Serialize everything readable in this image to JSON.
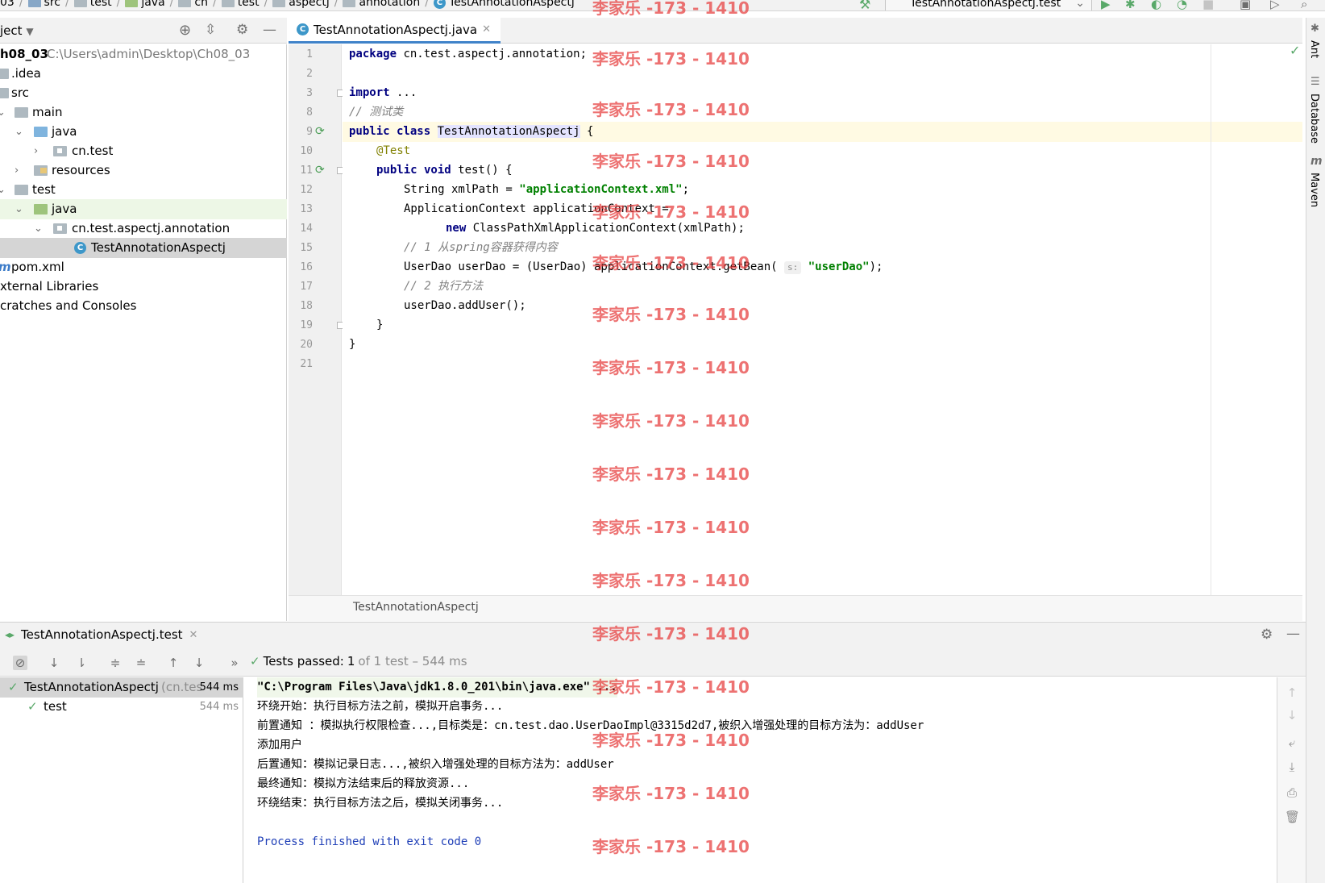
{
  "breadcrumb": [
    "03",
    "src",
    "test",
    "java",
    "cn",
    "test",
    "aspectj",
    "annotation",
    "TestAnnotationAspectj"
  ],
  "run_config": {
    "label": "TestAnnotationAspectj.test"
  },
  "project_panel": {
    "title": "ject",
    "tree": [
      {
        "label": "h08_03",
        "path": "C:\\Users\\admin\\Desktop\\Ch08_03",
        "bold": true
      },
      {
        "label": ".idea"
      },
      {
        "label": "src"
      },
      {
        "label": "main"
      },
      {
        "label": "java"
      },
      {
        "label": "cn.test"
      },
      {
        "label": "resources"
      },
      {
        "label": "test"
      },
      {
        "label": "java"
      },
      {
        "label": "cn.test.aspectj.annotation"
      },
      {
        "label": "TestAnnotationAspectj"
      },
      {
        "label": "pom.xml"
      },
      {
        "label": "xternal Libraries"
      },
      {
        "label": "cratches and Consoles"
      }
    ]
  },
  "editor": {
    "tab_label": "TestAnnotationAspectj.java",
    "footer_label": "TestAnnotationAspectj",
    "line_numbers": [
      "1",
      "2",
      "3",
      "8",
      "9",
      "10",
      "11",
      "12",
      "13",
      "14",
      "15",
      "16",
      "17",
      "18",
      "19",
      "20",
      "21"
    ],
    "code": {
      "l1_kw": "package",
      "l1_rest": " cn.test.aspectj.annotation;",
      "l3_kw": "import",
      "l3_rest": " ...",
      "l8": "// 测试类",
      "l9_kw": "public class",
      "l9_cls": "TestAnnotationAspectj",
      "l9_rest": " {",
      "l10": "@Test",
      "l11_kw": "public void",
      "l11_rest": " test() {",
      "l12_a": "String xmlPath = ",
      "l12_str": "\"applicationContext.xml\"",
      "l12_b": ";",
      "l13": "ApplicationContext applicationContext =",
      "l14_kw": "new",
      "l14_rest": " ClassPathXmlApplicationContext(xmlPath);",
      "l15": "// 1 从spring容器获得内容",
      "l16_a": "UserDao userDao = (UserDao) applicationContext.getBean(",
      "l16_hint": "s:",
      "l16_str": "\"userDao\"",
      "l16_b": ");",
      "l17": "// 2 执行方法",
      "l18": "userDao.addUser();",
      "l19": "}",
      "l20": "}"
    }
  },
  "right_tools": [
    "Ant",
    "Database",
    "Maven"
  ],
  "run_panel": {
    "tab_label": "TestAnnotationAspectj.test",
    "status_prefix": "Tests passed:",
    "status_count": "1",
    "status_rest": "of 1 test – 544 ms",
    "tests": [
      {
        "name": "TestAnnotationAspectj",
        "detail": "(cn.tes",
        "time": "544 ms"
      },
      {
        "name": "test",
        "time": "544 ms"
      }
    ],
    "console": [
      "\"C:\\Program Files\\Java\\jdk1.8.0_201\\bin\\java.exe\" ...",
      "环绕开始：执行目标方法之前，模拟开启事务...",
      "前置通知 ：模拟执行权限检查...,目标类是：cn.test.dao.UserDaoImpl@3315d2d7,被织入增强处理的目标方法为：addUser",
      "添加用户",
      "后置通知：模拟记录日志...,被织入增强处理的目标方法为：addUser",
      "最终通知：模拟方法结束后的释放资源...",
      "环绕结束：执行目标方法之后，模拟关闭事务...",
      "",
      "Process finished with exit code 0"
    ]
  },
  "watermark": "李家乐 -173 - 1410"
}
